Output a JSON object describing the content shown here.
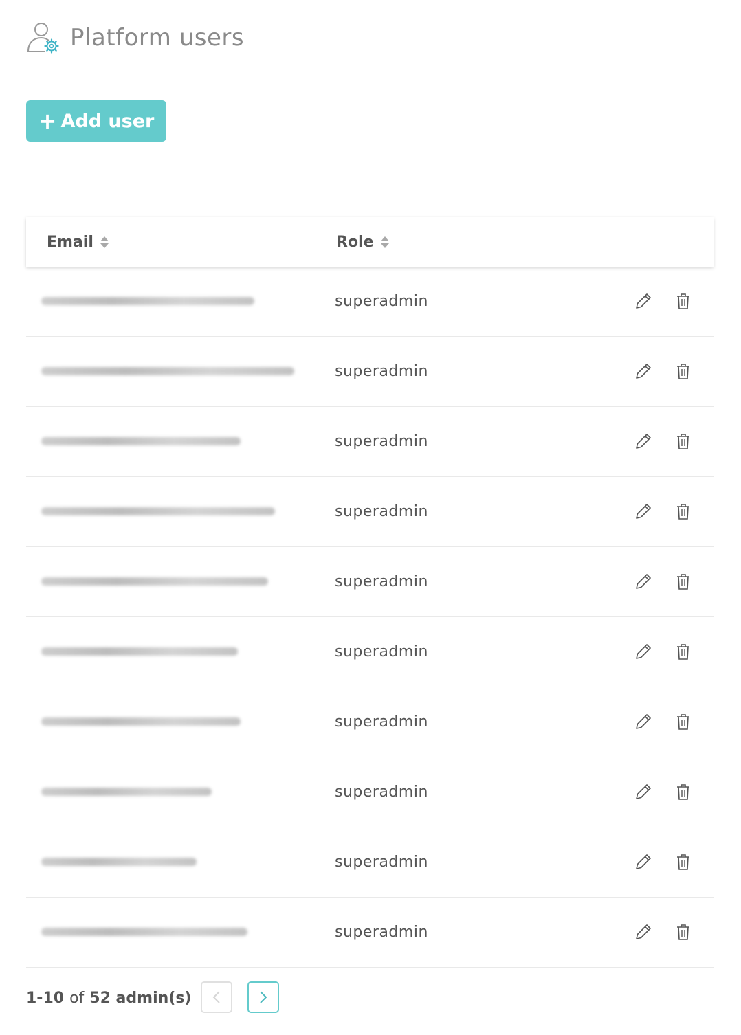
{
  "page": {
    "title": "Platform users",
    "icon": "user-gear-icon"
  },
  "toolbar": {
    "add_label": "Add user",
    "add_icon": "plus-icon"
  },
  "table": {
    "columns": [
      {
        "label": "Email",
        "sortable": true
      },
      {
        "label": "Role",
        "sortable": true
      }
    ],
    "rows": [
      {
        "role": "superadmin"
      },
      {
        "role": "superadmin"
      },
      {
        "role": "superadmin"
      },
      {
        "role": "superadmin"
      },
      {
        "role": "superadmin"
      },
      {
        "role": "superadmin"
      },
      {
        "role": "superadmin"
      },
      {
        "role": "superadmin"
      },
      {
        "role": "superadmin"
      },
      {
        "role": "superadmin"
      }
    ],
    "row_actions": [
      "pencil-icon",
      "trash-icon"
    ]
  },
  "pagination": {
    "range": "1-10",
    "of": "of",
    "total": "52 admin(s)"
  },
  "colors": {
    "accent": "#64cbcc",
    "text": "#555555",
    "muted": "#8a8a8a"
  }
}
